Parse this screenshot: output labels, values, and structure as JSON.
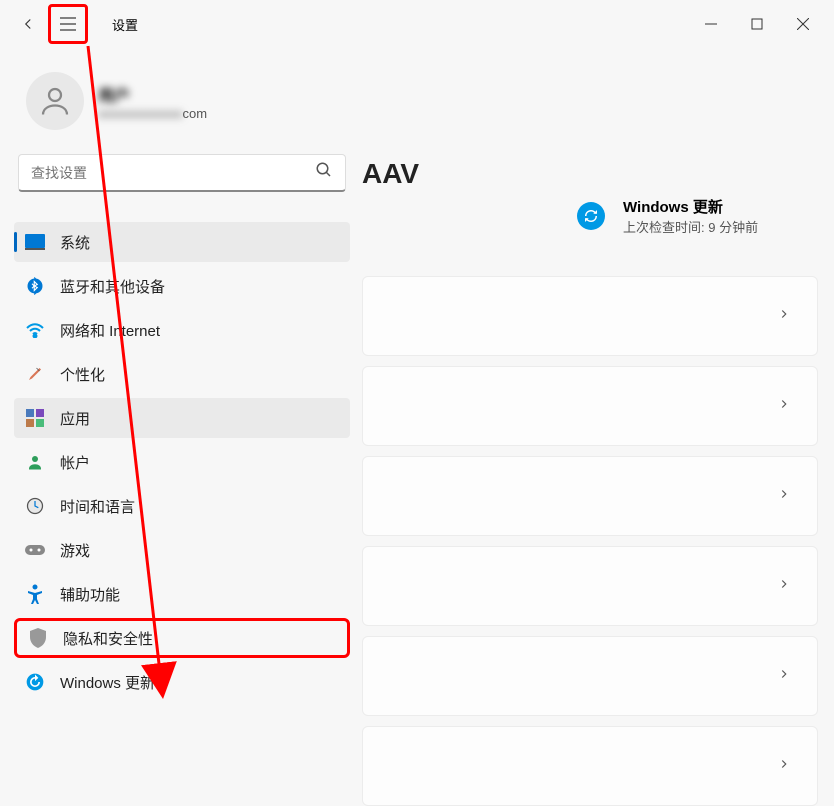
{
  "app": {
    "title": "设置"
  },
  "user": {
    "name": "用户",
    "email_suffix": "com"
  },
  "search": {
    "placeholder": "查找设置"
  },
  "sidebar": {
    "items": [
      {
        "label": "系统"
      },
      {
        "label": "蓝牙和其他设备"
      },
      {
        "label": "网络和 Internet"
      },
      {
        "label": "个性化"
      },
      {
        "label": "应用"
      },
      {
        "label": "帐户"
      },
      {
        "label": "时间和语言"
      },
      {
        "label": "游戏"
      },
      {
        "label": "辅助功能"
      },
      {
        "label": "隐私和安全性"
      },
      {
        "label": "Windows 更新"
      }
    ]
  },
  "content": {
    "heading_fragment": "AAV",
    "update": {
      "title": "Windows 更新",
      "subtitle": "上次检查时间: 9 分钟前"
    }
  }
}
